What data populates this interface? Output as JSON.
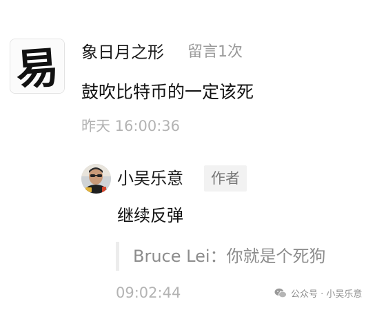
{
  "comment": {
    "nickname": "象日月之形",
    "count_tag": "留言1次",
    "text": "鼓吹比特币的一定该死",
    "time": "昨天 16:00:36",
    "avatar_glyph": "易"
  },
  "reply": {
    "nickname": "小吴乐意",
    "badge": "作者",
    "text": "继续反弹",
    "quote": "Bruce Lei：你就是个死狗",
    "time": "09:02:44"
  },
  "watermark": {
    "text": "公众号 · 小吴乐意",
    "icon": "wechat-official-account-icon"
  }
}
